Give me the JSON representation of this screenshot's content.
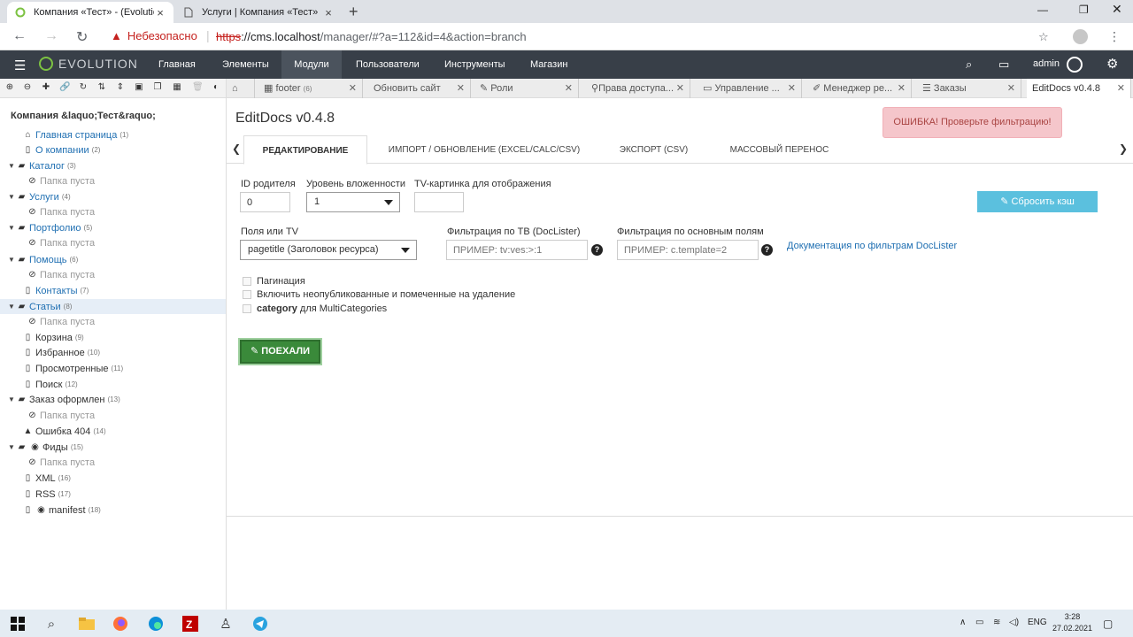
{
  "browser": {
    "tabs": [
      {
        "title": "Компания «Тест» - (Evolution CMS Manager)"
      },
      {
        "title": "Услуги | Компания «Тест»"
      }
    ],
    "warning": "Небезопасно",
    "url_scheme": "https",
    "url_rest": "://cms.localhost",
    "url_path": "/manager/#?a=112&id=4&action=branch"
  },
  "topbar": {
    "logo": "EVOLUTION",
    "menu": [
      "Главная",
      "Элементы",
      "Модули",
      "Пользователи",
      "Инструменты",
      "Магазин"
    ],
    "user": "admin"
  },
  "module_tabs": [
    {
      "label": "footer",
      "count": "(6)"
    },
    {
      "label": "Обновить сайт",
      "count": ""
    },
    {
      "label": "Роли",
      "count": ""
    },
    {
      "label": "Права доступа...",
      "count": ""
    },
    {
      "label": "Управление ...",
      "count": ""
    },
    {
      "label": "Менеджер ре...",
      "count": ""
    },
    {
      "label": "Заказы",
      "count": ""
    },
    {
      "label": "EditDocs v0.4.8",
      "count": ""
    }
  ],
  "tree": {
    "root": "Компания &laquo;Тест&raquo;",
    "nodes": [
      {
        "label": "Главная страница",
        "n": "(1)"
      },
      {
        "label": "О компании",
        "n": "(2)"
      },
      {
        "label": "Каталог",
        "n": "(3)"
      },
      {
        "label": "Папка пуста",
        "n": ""
      },
      {
        "label": "Услуги",
        "n": "(4)"
      },
      {
        "label": "Папка пуста",
        "n": ""
      },
      {
        "label": "Портфолио",
        "n": "(5)"
      },
      {
        "label": "Папка пуста",
        "n": ""
      },
      {
        "label": "Помощь",
        "n": "(6)"
      },
      {
        "label": "Папка пуста",
        "n": ""
      },
      {
        "label": "Контакты",
        "n": "(7)"
      },
      {
        "label": "Статьи",
        "n": "(8)"
      },
      {
        "label": "Папка пуста",
        "n": ""
      },
      {
        "label": "Корзина",
        "n": "(9)"
      },
      {
        "label": "Избранное",
        "n": "(10)"
      },
      {
        "label": "Просмотренные",
        "n": "(11)"
      },
      {
        "label": "Поиск",
        "n": "(12)"
      },
      {
        "label": "Заказ оформлен",
        "n": "(13)"
      },
      {
        "label": "Папка пуста",
        "n": ""
      },
      {
        "label": "Ошибка 404",
        "n": "(14)"
      },
      {
        "label": "Фиды",
        "n": "(15)"
      },
      {
        "label": "Папка пуста",
        "n": ""
      },
      {
        "label": "XML",
        "n": "(16)"
      },
      {
        "label": "RSS",
        "n": "(17)"
      },
      {
        "label": "manifest",
        "n": "(18)"
      }
    ]
  },
  "page": {
    "title": "EditDocs v0.4.8",
    "error": "ОШИБКА! Проверьте фильтрацию!",
    "tabs": [
      "Редактирование",
      "Импорт / Обновление (Excel/Calc/CSV)",
      "Экспорт (CSV)",
      "Массовый перенос"
    ],
    "parent_id_label": "ID родителя",
    "parent_id_value": "0",
    "depth_label": "Уровень вложенности",
    "depth_value": "1",
    "tv_image_label": "TV-картинка для отображения",
    "tv_image_value": "",
    "reset_cache": "Сбросить кэш",
    "fields_label": "Поля или TV",
    "fields_value": "pagetitle (Заголовок ресурса)",
    "filter_tv_label": "Фильтрация по ТВ (DocLister)",
    "filter_tv_placeholder": "ПРИМЕР: tv:ves:>:1",
    "filter_main_label": "Фильтрация по основным полям",
    "filter_main_placeholder": "ПРИМЕР: c.template=2",
    "doc_link": "Документация по фильтрам DocLister",
    "cb_pagination": "Пагинация",
    "cb_unpublished": "Включить неопубликованные и помеченные на удаление",
    "cb_category_bold": "category",
    "cb_category_rest": " для MultiCategories",
    "go": "ПОЕХАЛИ"
  },
  "taskbar": {
    "lang": "ENG",
    "time": "3:28",
    "date": "27.02.2021"
  }
}
